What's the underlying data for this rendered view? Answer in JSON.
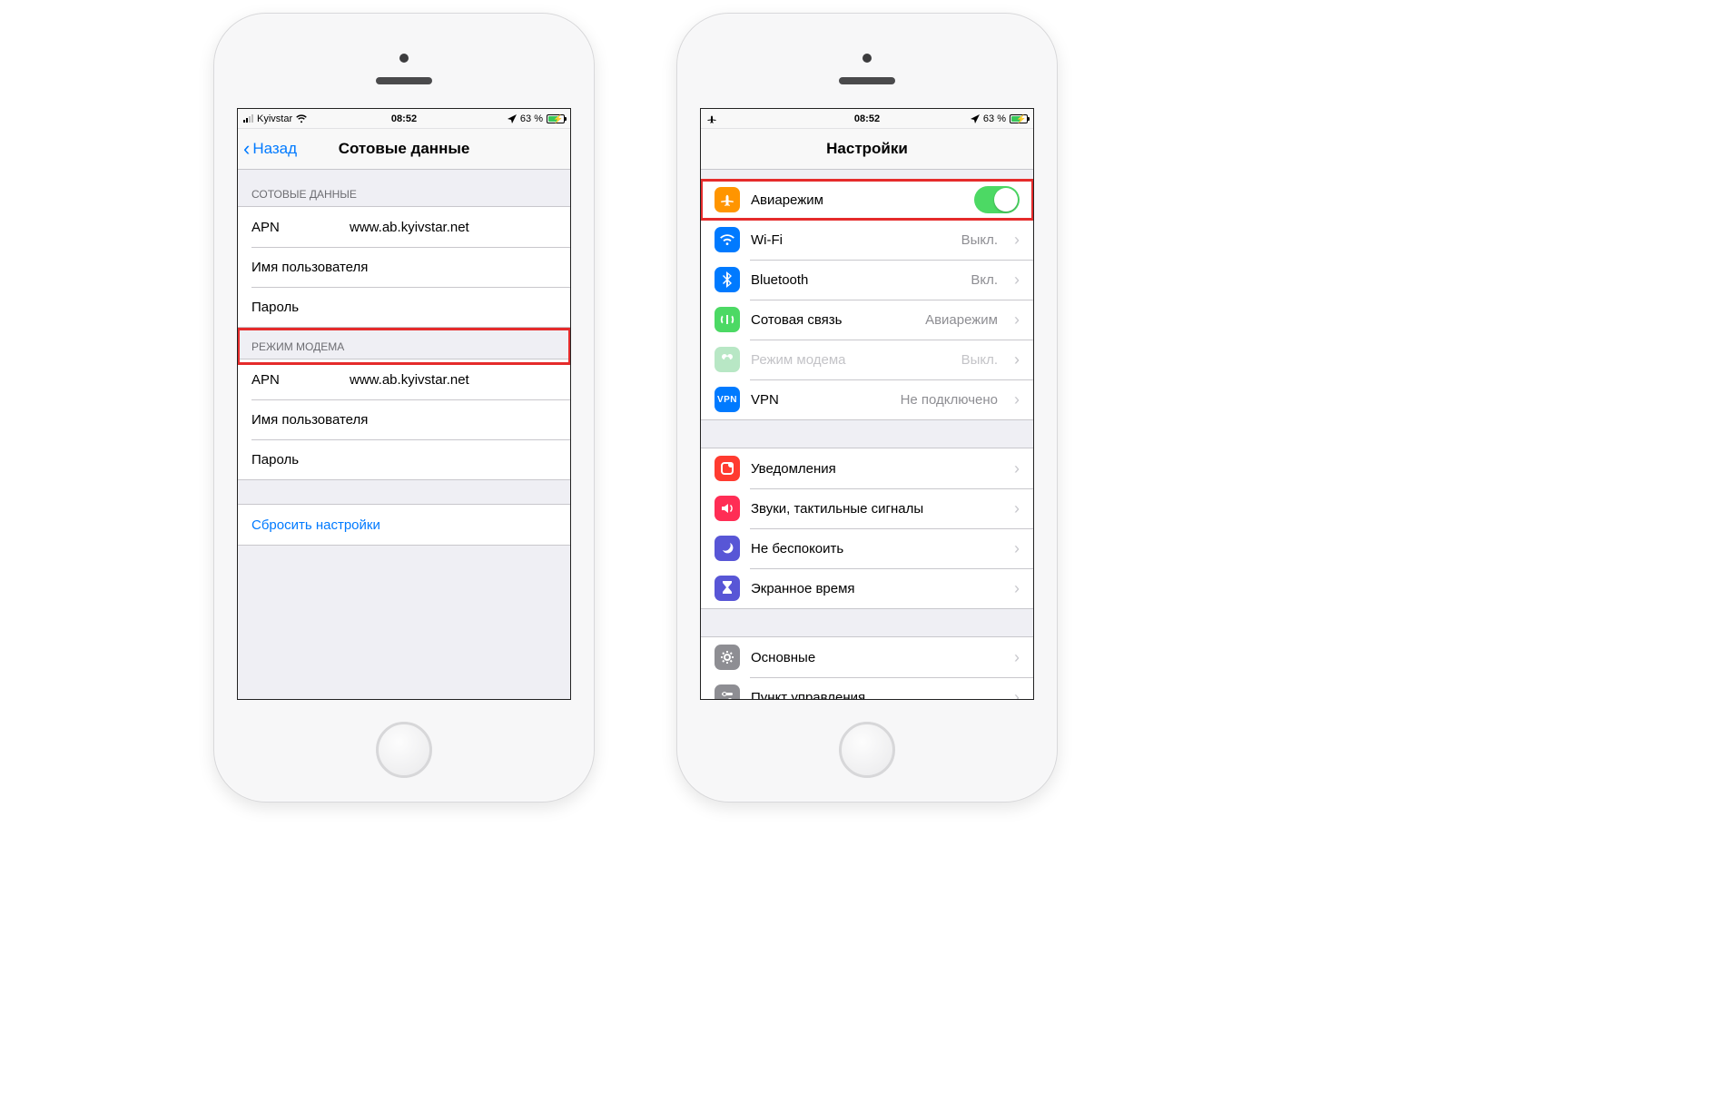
{
  "status": {
    "carrier": "Kyivstar",
    "time": "08:52",
    "battery_pct": "63 %"
  },
  "left": {
    "nav": {
      "back": "Назад",
      "title": "Сотовые данные"
    },
    "section1_header": "СОТОВЫЕ ДАННЫЕ",
    "section2_header": "РЕЖИМ МОДЕМА",
    "rows": {
      "apn_label": "APN",
      "apn_value": "www.ab.kyivstar.net",
      "user_label": "Имя пользователя",
      "pass_label": "Пароль"
    },
    "reset": "Сбросить настройки"
  },
  "right": {
    "nav_title": "Настройки",
    "items": [
      {
        "key": "airplane",
        "label": "Авиарежим",
        "detail": "",
        "toggle": true
      },
      {
        "key": "wifi",
        "label": "Wi-Fi",
        "detail": "Выкл."
      },
      {
        "key": "bt",
        "label": "Bluetooth",
        "detail": "Вкл."
      },
      {
        "key": "cell",
        "label": "Сотовая связь",
        "detail": "Авиарежим"
      },
      {
        "key": "hotspot",
        "label": "Режим модема",
        "detail": "Выкл.",
        "disabled": true
      },
      {
        "key": "vpn",
        "label": "VPN",
        "detail": "Не подключено"
      }
    ],
    "items2": [
      {
        "key": "notif",
        "label": "Уведомления"
      },
      {
        "key": "sound",
        "label": "Звуки, тактильные сигналы"
      },
      {
        "key": "dnd",
        "label": "Не беспокоить"
      },
      {
        "key": "screen",
        "label": "Экранное время"
      }
    ],
    "items3": [
      {
        "key": "general",
        "label": "Основные"
      },
      {
        "key": "control",
        "label": "Пункт управления"
      }
    ],
    "vpn_badge": "VPN"
  }
}
